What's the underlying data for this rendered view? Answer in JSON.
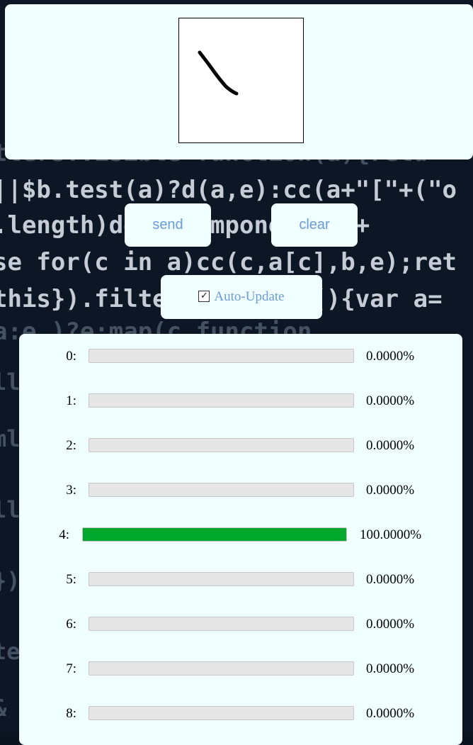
{
  "buttons": {
    "send": "send",
    "clear": "clear"
  },
  "auto_update": {
    "label": "Auto-Update",
    "checked": true
  },
  "predictions": [
    {
      "label": "0:",
      "value": "0.0000%",
      "fraction": 0
    },
    {
      "label": "1:",
      "value": "0.0000%",
      "fraction": 0
    },
    {
      "label": "2:",
      "value": "0.0000%",
      "fraction": 0
    },
    {
      "label": "3:",
      "value": "0.0000%",
      "fraction": 0
    },
    {
      "label": "4:",
      "value": "100.0000%",
      "fraction": 1
    },
    {
      "label": "5:",
      "value": "0.0000%",
      "fraction": 0
    },
    {
      "label": "6:",
      "value": "0.0000%",
      "fraction": 0
    },
    {
      "label": "7:",
      "value": "0.0000%",
      "fraction": 0
    },
    {
      "label": "8:",
      "value": "0.0000%",
      "fraction": 0
    }
  ],
  "colors": {
    "panel": "#f0ffff",
    "accent": "#6b9bd8",
    "bar_fill": "#00a82d",
    "bar_track": "#e6e6e6"
  }
}
